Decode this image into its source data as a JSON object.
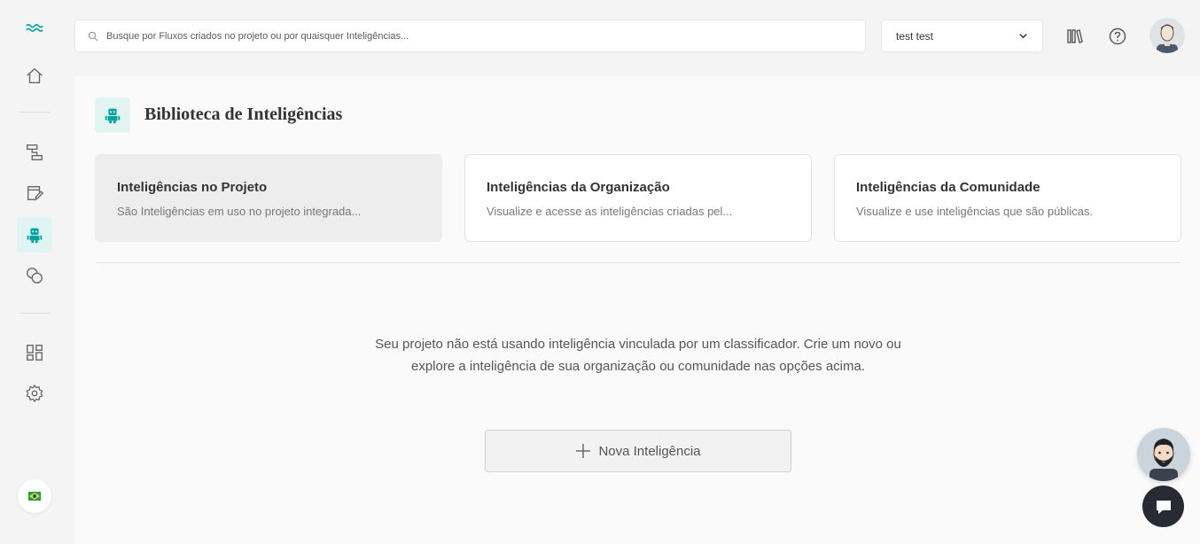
{
  "header": {
    "search_placeholder": "Busque por Fluxos criados no projeto ou por quaisquer Inteligências...",
    "project_name": "test test"
  },
  "page": {
    "title": "Biblioteca de Inteligências"
  },
  "cards": [
    {
      "title": "Inteligências no Projeto",
      "description": "São Inteligências em uso no projeto integrada..."
    },
    {
      "title": "Inteligências da Organização",
      "description": "Visualize e acesse as inteligências criadas pel..."
    },
    {
      "title": "Inteligências da Comunidade",
      "description": "Visualize e use inteligências que são públicas."
    }
  ],
  "empty_state": {
    "message": "Seu projeto não está usando inteligência vinculada por um classificador. Crie um novo ou explore a inteligência de sua organização ou comunidade nas opções acima.",
    "button_label": "Nova Inteligência"
  },
  "colors": {
    "accent": "#00a49f",
    "active_bg": "#e0f5f3",
    "chat_button": "#272b33"
  },
  "icons": {
    "logo": "weni-logo-icon",
    "nav": [
      "home-icon",
      "flows-icon",
      "studio-icon",
      "intelligence-robot-icon",
      "chats-icon",
      "dashboard-icon",
      "settings-icon"
    ],
    "language": "brazil-flag-icon"
  }
}
